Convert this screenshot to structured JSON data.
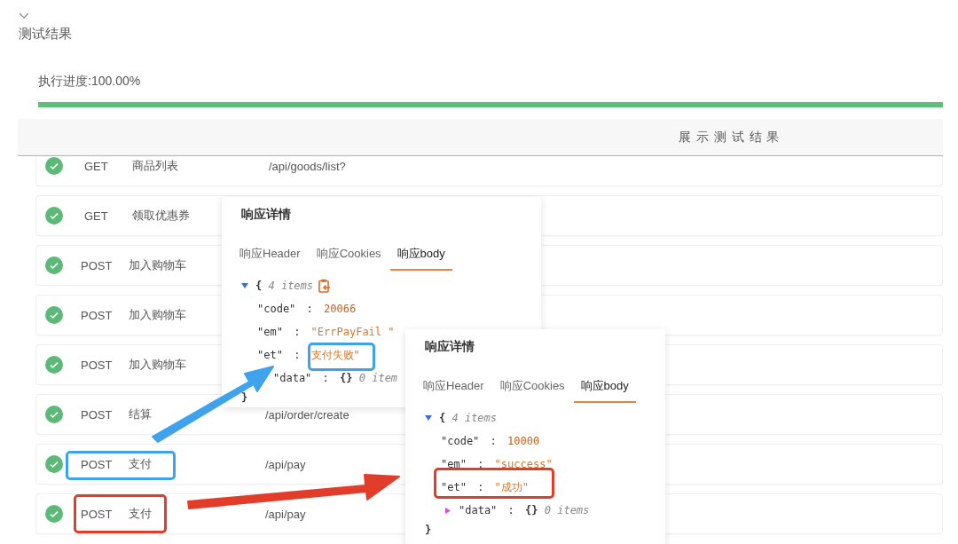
{
  "section": {
    "title": "测试结果",
    "expanded": true
  },
  "progress": {
    "label": "执行进度:100.00%",
    "level": 1
  },
  "table": {
    "header": "展 示 测 试 结 果",
    "rows": [
      {
        "passed": true,
        "method": "GET",
        "name": "商品列表",
        "path": "/api/goods/list?"
      },
      {
        "passed": true,
        "method": "GET",
        "name": "领取优惠券"
      },
      {
        "passed": true,
        "method": "POST",
        "name": "加入购物车"
      },
      {
        "passed": true,
        "method": "POST",
        "name": "加入购物车"
      },
      {
        "passed": true,
        "method": "POST",
        "name": "加入购物车"
      },
      {
        "passed": true,
        "method": "POST",
        "name": "结算",
        "path": "/api/order/create"
      },
      {
        "passed": true,
        "method": "POST",
        "name": "支付",
        "path": "/api/pay"
      },
      {
        "passed": true,
        "method": "POST",
        "name": "支付",
        "path": "/api/pay"
      }
    ]
  },
  "popovers": [
    {
      "title": "响应详情",
      "tabs": [
        {
          "label": "响应Header",
          "selected": false
        },
        {
          "label": "响应Cookies",
          "selected": false
        },
        {
          "label": "响应body",
          "selected": true
        }
      ],
      "lines": [
        {
          "kind": "open",
          "brace": "{",
          "summary": "4 items",
          "expanded": true,
          "copy_icon": true
        },
        {
          "kind": "pair",
          "key": "\"code\"",
          "colon": ":",
          "value": "20066"
        },
        {
          "kind": "pair",
          "key": "\"em\"",
          "colon": ":",
          "value": "\"ErrPayFail \""
        },
        {
          "kind": "pair",
          "key": "\"et\"",
          "colon": ":",
          "value": "支付失败\""
        },
        {
          "kind": "object",
          "key": "\"data\"",
          "colon": ":",
          "value": "{}",
          "summary": "0 item"
        },
        {
          "kind": "close",
          "brace": "}"
        }
      ]
    },
    {
      "title": "响应详情",
      "tabs": [
        {
          "label": "响应Header",
          "selected": false
        },
        {
          "label": "响应Cookies",
          "selected": false
        },
        {
          "label": "响应body",
          "selected": true
        }
      ],
      "lines": [
        {
          "kind": "open",
          "brace": "{",
          "summary": "4 items",
          "expanded": true
        },
        {
          "kind": "pair",
          "key": "\"code\"",
          "colon": ":",
          "value": "10000"
        },
        {
          "kind": "pair",
          "key": "\"em\"",
          "colon": ":",
          "value": "\"success\""
        },
        {
          "kind": "pair",
          "key": "\"et\"",
          "colon": ":",
          "value": "\"成功\""
        },
        {
          "kind": "object",
          "key": "\"data\"",
          "colon": ":",
          "value": "{}",
          "summary": "0 items",
          "expanded": false
        },
        {
          "kind": "close",
          "brace": "}"
        }
      ]
    }
  ],
  "annotations": {
    "highlights": [
      {
        "color": "#3ea3ec"
      },
      {
        "color": "#3ea3ec"
      },
      {
        "color": "#e23d2b"
      },
      {
        "color": "#e23d2b"
      }
    ],
    "arrows": [
      {
        "color": "#3ea3ec"
      },
      {
        "color": "#e23d2b"
      }
    ]
  }
}
